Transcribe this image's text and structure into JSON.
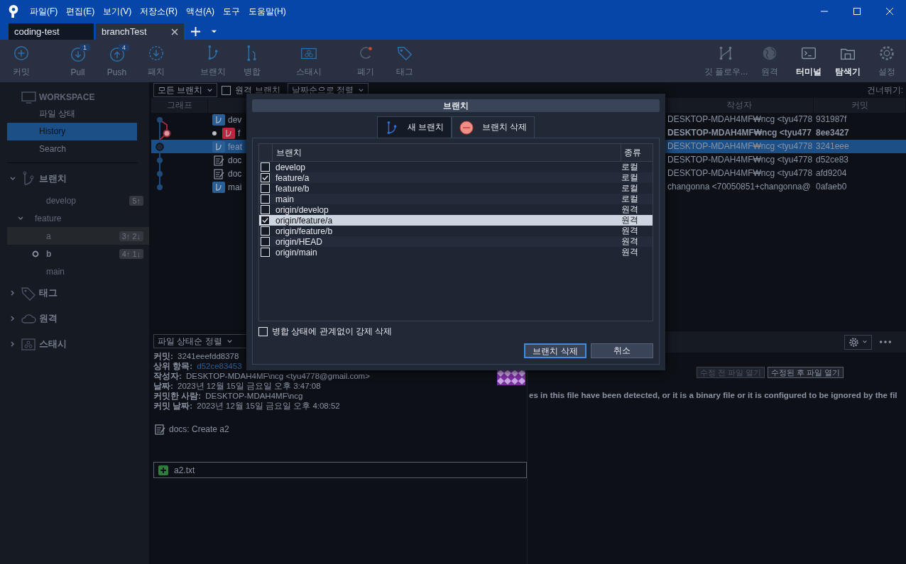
{
  "menu": [
    "파일(F)",
    "편집(E)",
    "보기(V)",
    "저장소(R)",
    "액션(A)",
    "도구",
    "도움말(H)"
  ],
  "tabs": [
    {
      "label": "coding-test",
      "selected": false
    },
    {
      "label": "branchTest",
      "selected": true
    }
  ],
  "toolbar_left": [
    {
      "label": "커밋"
    },
    {
      "label": "Pull",
      "badge": "1"
    },
    {
      "label": "Push",
      "badge": "4"
    },
    {
      "label": "패치"
    },
    {
      "label": "브랜치"
    },
    {
      "label": "병합"
    },
    {
      "label": "스태시"
    },
    {
      "label": "폐기"
    },
    {
      "label": "태그"
    }
  ],
  "toolbar_right": [
    {
      "label": "깃 플로우...",
      "highlighted": false
    },
    {
      "label": "원격",
      "highlighted": false
    },
    {
      "label": "터미널",
      "highlighted": true
    },
    {
      "label": "탐색기",
      "highlighted": true
    },
    {
      "label": "설정",
      "highlighted": false
    }
  ],
  "sidebar": {
    "workspace_title": "WORKSPACE",
    "workspace_items": [
      {
        "label": "파일 상태",
        "selected": false
      },
      {
        "label": "History",
        "selected": true
      },
      {
        "label": "Search",
        "selected": false
      }
    ],
    "sections": [
      {
        "label": "브랜치",
        "expanded": true,
        "children": [
          {
            "label": "develop",
            "badge": "5↑",
            "current": false,
            "selected": false
          },
          {
            "label": "feature",
            "expanded": true,
            "children": [
              {
                "label": "a",
                "badge": "3↑ 2↓",
                "current": false,
                "selected": true
              },
              {
                "label": "b",
                "badge": "4↑ 1↓",
                "current": true,
                "selected": false
              }
            ]
          },
          {
            "label": "main",
            "current": false,
            "selected": false
          }
        ]
      },
      {
        "label": "태그",
        "expanded": false
      },
      {
        "label": "원격",
        "expanded": false
      },
      {
        "label": "스태시",
        "expanded": false
      }
    ]
  },
  "history": {
    "branch_filter": "모든 브랜치",
    "remote_branches": {
      "label": "원격 브랜치",
      "checked": false
    },
    "sort": "날짜순으로 정렬",
    "jump_label": "건너뛰기:",
    "columns": [
      "그래프",
      "작성자",
      "커밋"
    ],
    "rows": [
      {
        "kind": "branch",
        "color": "#2a5f96",
        "current": false,
        "description": "dev",
        "author": "DESKTOP-MDAH4MF₩ncg <tyu4778",
        "commit": "931987f",
        "bold": false,
        "selected": false
      },
      {
        "kind": "branch",
        "color": "#b8283e",
        "current": true,
        "description": "f",
        "author": "DESKTOP-MDAH4MF₩ncg <tyu477",
        "commit": "8ee3427",
        "bold": true,
        "selected": false
      },
      {
        "kind": "branch",
        "color": "#2a5f96",
        "current": false,
        "description": "feat",
        "author": "DESKTOP-MDAH4MF₩ncg <tyu4778",
        "commit": "3241eee",
        "bold": false,
        "selected": true
      },
      {
        "kind": "commit",
        "description": "doc",
        "author": "DESKTOP-MDAH4MF₩ncg <tyu4778",
        "commit": "d52ce83",
        "bold": false,
        "selected": false
      },
      {
        "kind": "commit",
        "description": "doc",
        "author": "DESKTOP-MDAH4MF₩ncg <tyu4778",
        "commit": "afd9204",
        "bold": false,
        "selected": false
      },
      {
        "kind": "branch",
        "color": "#2a5f96",
        "current": false,
        "description": "mai",
        "author": "changonna <70050851+changonna@",
        "commit": "0afaeb0",
        "bold": false,
        "selected": false
      }
    ]
  },
  "details": {
    "sort": "파일 상태순 정렬",
    "fields": [
      {
        "label": "커밋:",
        "value": "3241eeefdd8378"
      },
      {
        "label": "상위 항목:",
        "value": "d52ce83453",
        "kind": "link"
      },
      {
        "label": "작성자:",
        "value": "DESKTOP-MDAH4MF\\ncg <tyu4778@gmail.com>"
      },
      {
        "label": "날짜:",
        "value": "2023년 12월 15일 금요일 오후 3:47:08"
      },
      {
        "label": "커밋한 사람:",
        "value": "DESKTOP-MDAH4MF\\ncg"
      },
      {
        "label": "커밋 날짜:",
        "value": "2023년 12월 15일 금요일 오후 4:08:52"
      }
    ],
    "message": "docs: Create a2",
    "files": [
      {
        "name": "a2.txt",
        "added": true
      }
    ]
  },
  "diff": {
    "buttons": [
      {
        "label": "수정 전 파일 열기",
        "disabled": true
      },
      {
        "label": "수정된 후 파일 열기",
        "disabled": false
      }
    ],
    "message": "es in this file have been detected, or it is a binary file or it is configured to be ignored by the fil"
  },
  "dialog": {
    "title": "브랜치",
    "tabs": [
      {
        "label": "새 브랜치",
        "selected": false
      },
      {
        "label": "브랜치 삭제",
        "selected": true
      }
    ],
    "columns": [
      "브랜치",
      "종류"
    ],
    "rows": [
      {
        "name": "develop",
        "type": "로컬",
        "checked": false,
        "selected": false
      },
      {
        "name": "feature/a",
        "type": "로컬",
        "checked": true,
        "selected": false
      },
      {
        "name": "feature/b",
        "type": "로컬",
        "checked": false,
        "selected": false
      },
      {
        "name": "main",
        "type": "로컬",
        "checked": false,
        "selected": false
      },
      {
        "name": "origin/develop",
        "type": "원격",
        "checked": false,
        "selected": false
      },
      {
        "name": "origin/feature/a",
        "type": "원격",
        "checked": true,
        "selected": true
      },
      {
        "name": "origin/feature/b",
        "type": "원격",
        "checked": false,
        "selected": false
      },
      {
        "name": "origin/HEAD",
        "type": "원격",
        "checked": false,
        "selected": false
      },
      {
        "name": "origin/main",
        "type": "원격",
        "checked": false,
        "selected": false
      }
    ],
    "force_delete": {
      "label": "병합 상태에 관계없이 강제 삭제",
      "checked": false
    },
    "buttons": [
      {
        "label": "브랜치 삭제",
        "primary": true
      },
      {
        "label": "취소",
        "primary": false
      }
    ]
  }
}
